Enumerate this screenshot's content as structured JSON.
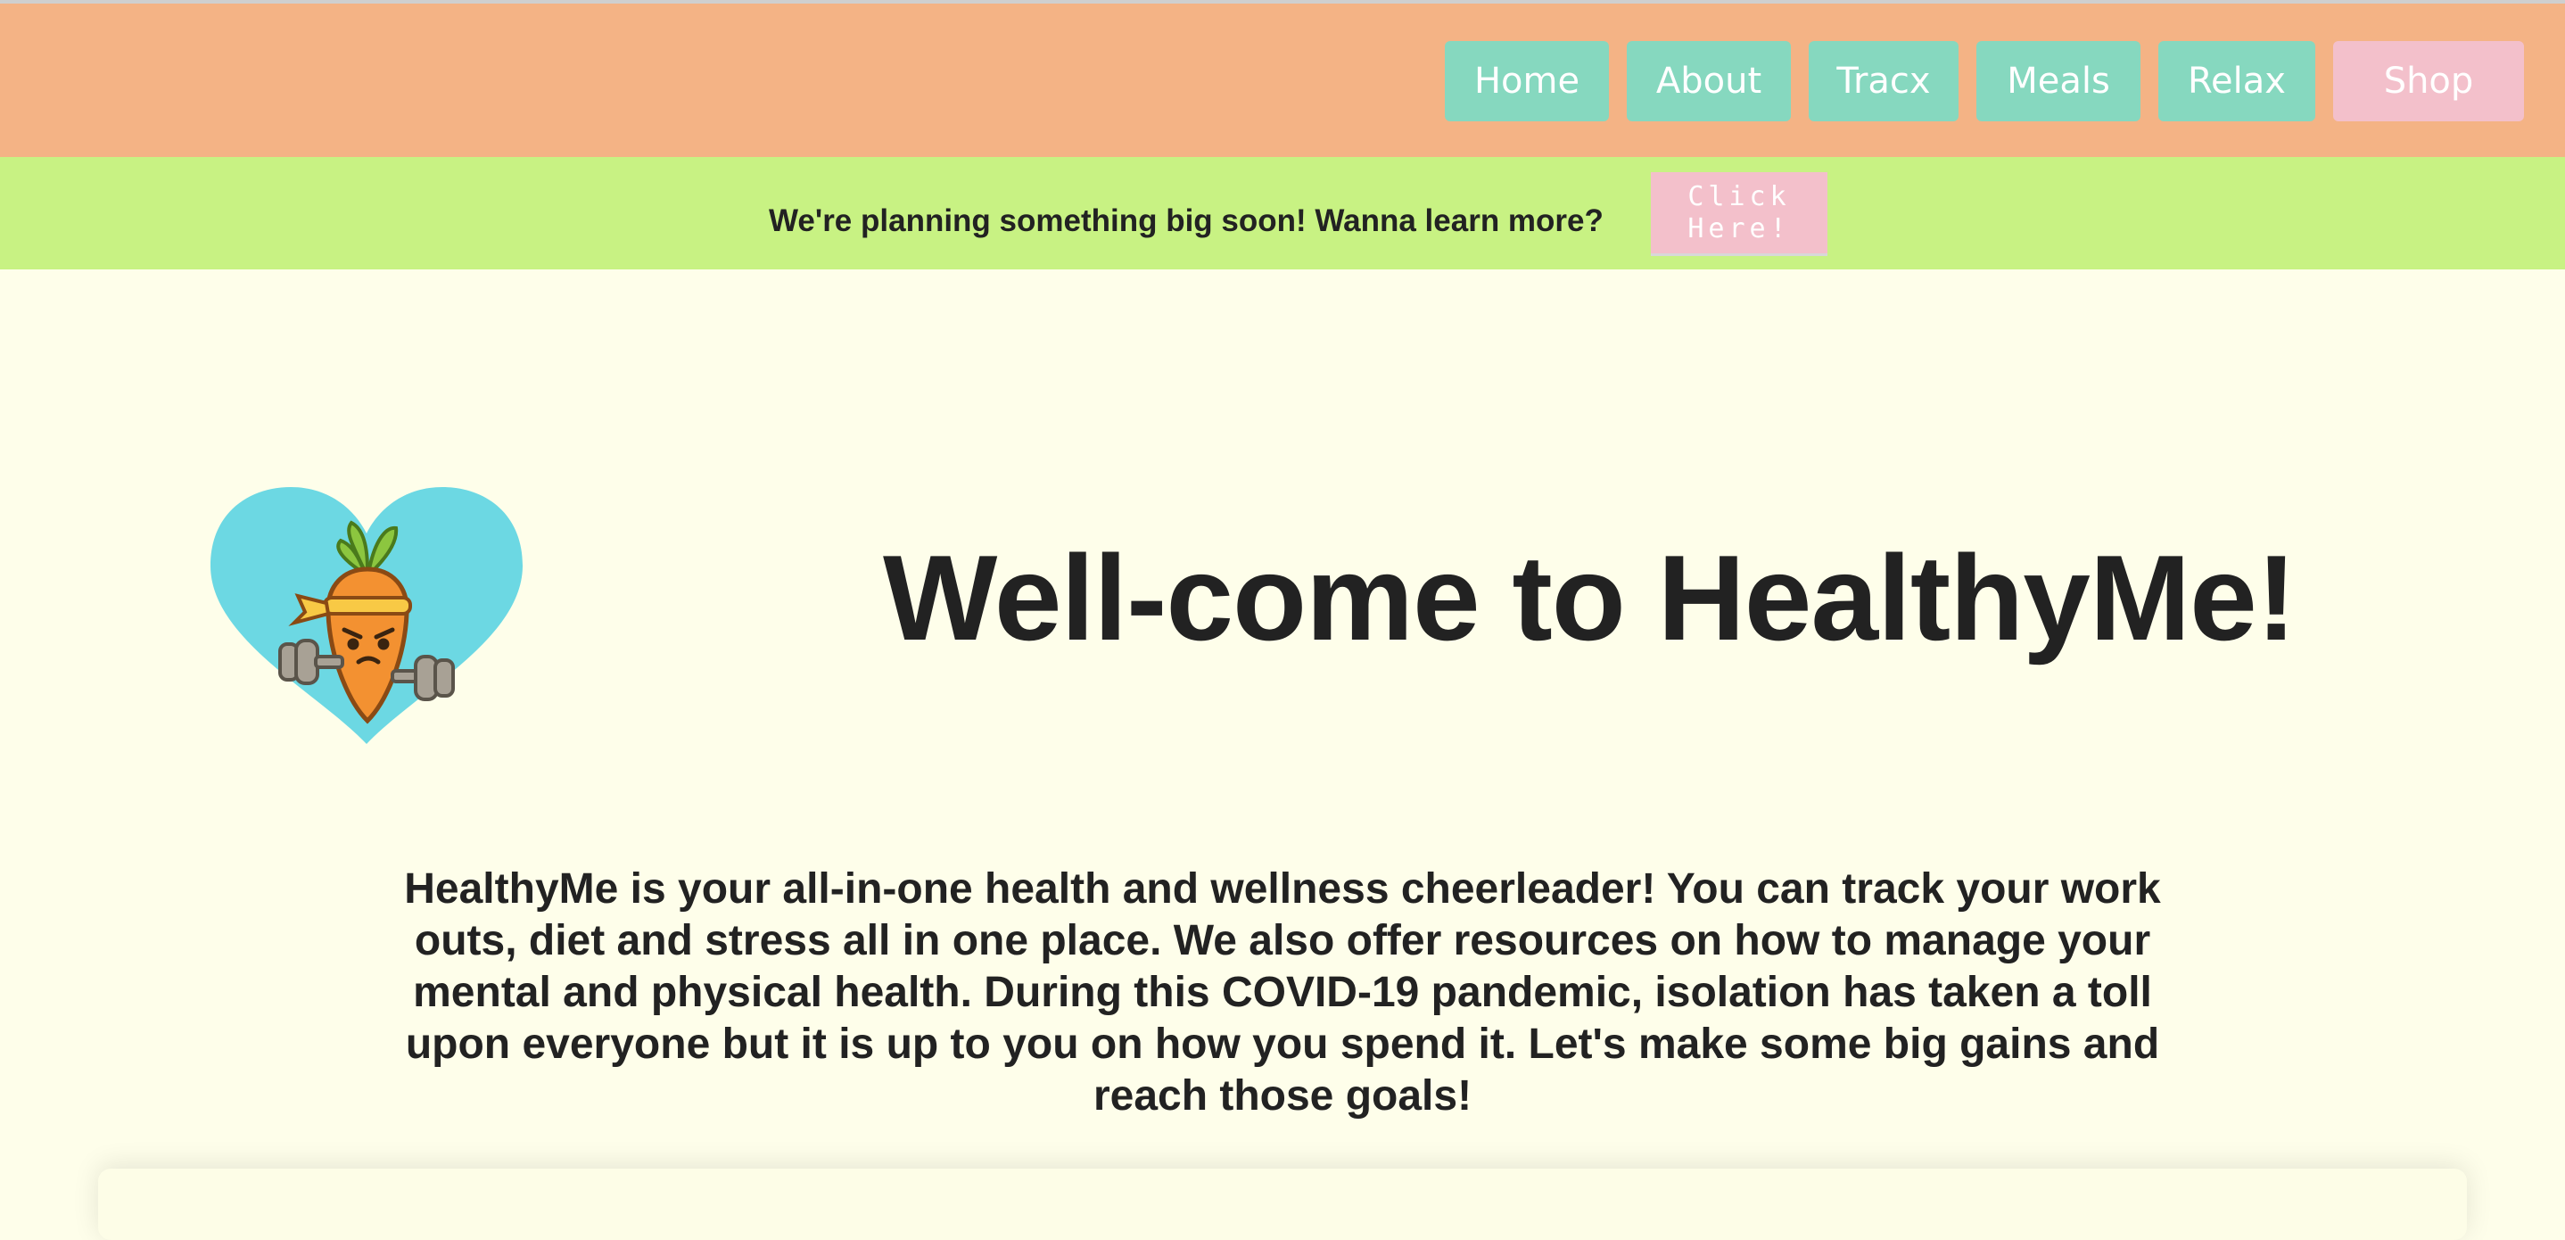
{
  "nav": {
    "items": [
      {
        "label": "Home"
      },
      {
        "label": "About"
      },
      {
        "label": "Tracx"
      },
      {
        "label": "Meals"
      },
      {
        "label": "Relax"
      },
      {
        "label": "Shop"
      }
    ]
  },
  "announcement": {
    "text": "We're planning something big soon! Wanna learn more?",
    "button_label": "Click Here!"
  },
  "hero": {
    "logo_icon": "carrot-heart-logo-icon",
    "title": "Well-come to HealthyMe!"
  },
  "intro": {
    "text": "HealthyMe is your all-in-one health and wellness cheerleader! You can track your work outs, diet and stress all in one place. We also offer resources on how to manage your mental and physical health. During this COVID-19 pandemic, isolation has taken a toll upon everyone but it is up to you on how you spend it. Let's make some big gains and reach those goals!"
  },
  "colors": {
    "header_bg": "#f4b385",
    "nav_button": "#86d8bf",
    "shop_button": "#f3c0cb",
    "announcement_bg": "#c8f283",
    "page_bg": "#fefeea",
    "heart": "#6cd8e3",
    "carrot": "#f39131"
  }
}
